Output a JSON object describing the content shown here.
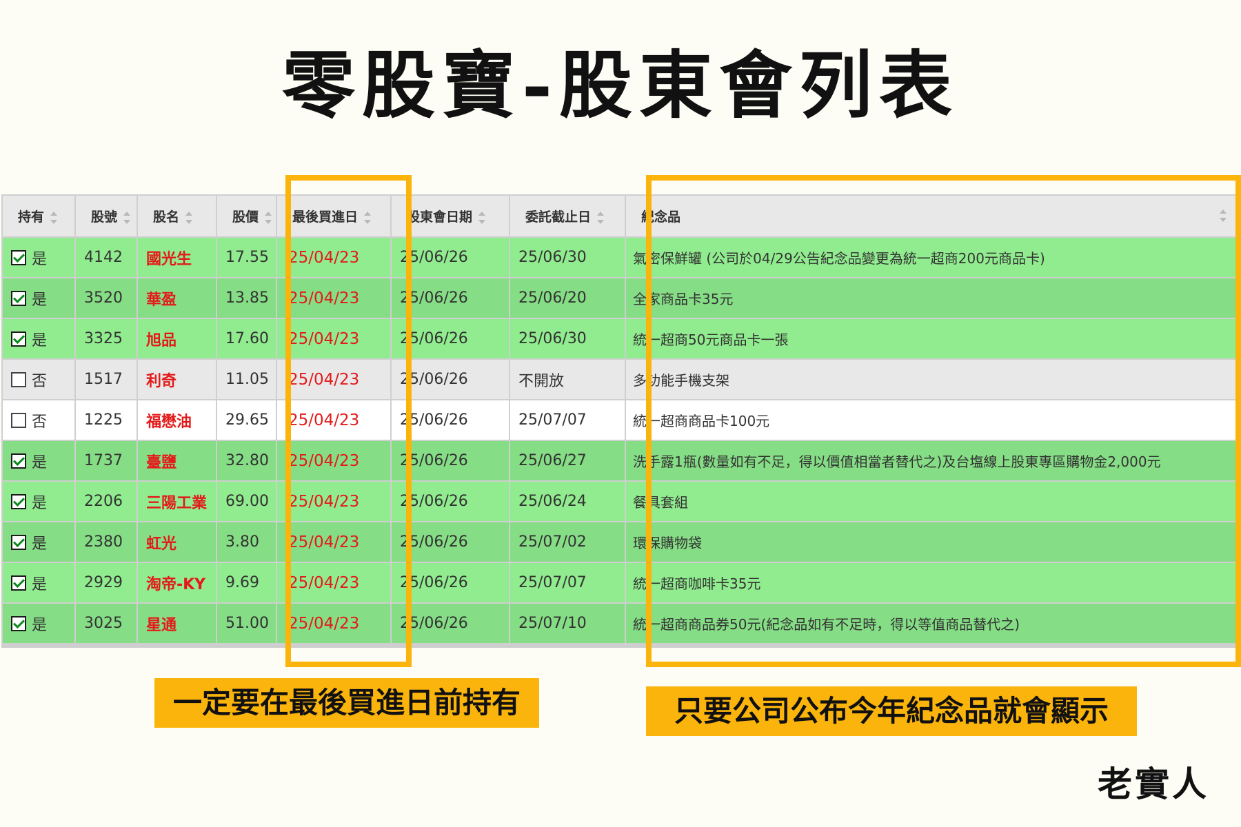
{
  "title": "零股寶-股東會列表",
  "table": {
    "headers": [
      "持有",
      "股號",
      "股名",
      "股價",
      "最後買進日",
      "股東會日期",
      "委託截止日",
      "紀念品"
    ],
    "rows": [
      {
        "checked": true,
        "hold": "是",
        "code": "4142",
        "name": "國光生",
        "price": "17.55",
        "last_buy": "25/04/23",
        "meeting": "25/06/26",
        "deadline": "25/06/30",
        "gift": "氣密保鮮罐 (公司於04/29公告紀念品變更為統一超商200元商品卡)"
      },
      {
        "checked": true,
        "hold": "是",
        "code": "3520",
        "name": "華盈",
        "price": "13.85",
        "last_buy": "25/04/23",
        "meeting": "25/06/26",
        "deadline": "25/06/20",
        "gift": "全家商品卡35元"
      },
      {
        "checked": true,
        "hold": "是",
        "code": "3325",
        "name": "旭品",
        "price": "17.60",
        "last_buy": "25/04/23",
        "meeting": "25/06/26",
        "deadline": "25/06/30",
        "gift": "統一超商50元商品卡一張"
      },
      {
        "checked": false,
        "hold": "否",
        "code": "1517",
        "name": "利奇",
        "price": "11.05",
        "last_buy": "25/04/23",
        "meeting": "25/06/26",
        "deadline": "不開放",
        "gift": "多功能手機支架"
      },
      {
        "checked": false,
        "hold": "否",
        "code": "1225",
        "name": "福懋油",
        "price": "29.65",
        "last_buy": "25/04/23",
        "meeting": "25/06/26",
        "deadline": "25/07/07",
        "gift": "統一超商商品卡100元"
      },
      {
        "checked": true,
        "hold": "是",
        "code": "1737",
        "name": "臺鹽",
        "price": "32.80",
        "last_buy": "25/04/23",
        "meeting": "25/06/26",
        "deadline": "25/06/27",
        "gift": "洗手露1瓶(數量如有不足，得以價值相當者替代之)及台塩線上股東專區購物金2,000元"
      },
      {
        "checked": true,
        "hold": "是",
        "code": "2206",
        "name": "三陽工業",
        "price": "69.00",
        "last_buy": "25/04/23",
        "meeting": "25/06/26",
        "deadline": "25/06/24",
        "gift": "餐具套組"
      },
      {
        "checked": true,
        "hold": "是",
        "code": "2380",
        "name": "虹光",
        "price": "3.80",
        "last_buy": "25/04/23",
        "meeting": "25/06/26",
        "deadline": "25/07/02",
        "gift": "環保購物袋"
      },
      {
        "checked": true,
        "hold": "是",
        "code": "2929",
        "name": "淘帝-KY",
        "price": "9.69",
        "last_buy": "25/04/23",
        "meeting": "25/06/26",
        "deadline": "25/07/07",
        "gift": "統一超商咖啡卡35元"
      },
      {
        "checked": true,
        "hold": "是",
        "code": "3025",
        "name": "星通",
        "price": "51.00",
        "last_buy": "25/04/23",
        "meeting": "25/06/26",
        "deadline": "25/07/10",
        "gift": "統一超商商品券50元(紀念品如有不足時，得以等值商品替代之)"
      }
    ]
  },
  "callouts": {
    "last_buy_note": "一定要在最後買進日前持有",
    "gift_note": "只要公司公布今年紀念品就會顯示"
  },
  "signature": "老實人",
  "colors": {
    "highlight": "#fbb40c",
    "held_row_light": "#90ec8e",
    "held_row_dark": "#85dd85",
    "stock_name": "#e41a1a"
  }
}
